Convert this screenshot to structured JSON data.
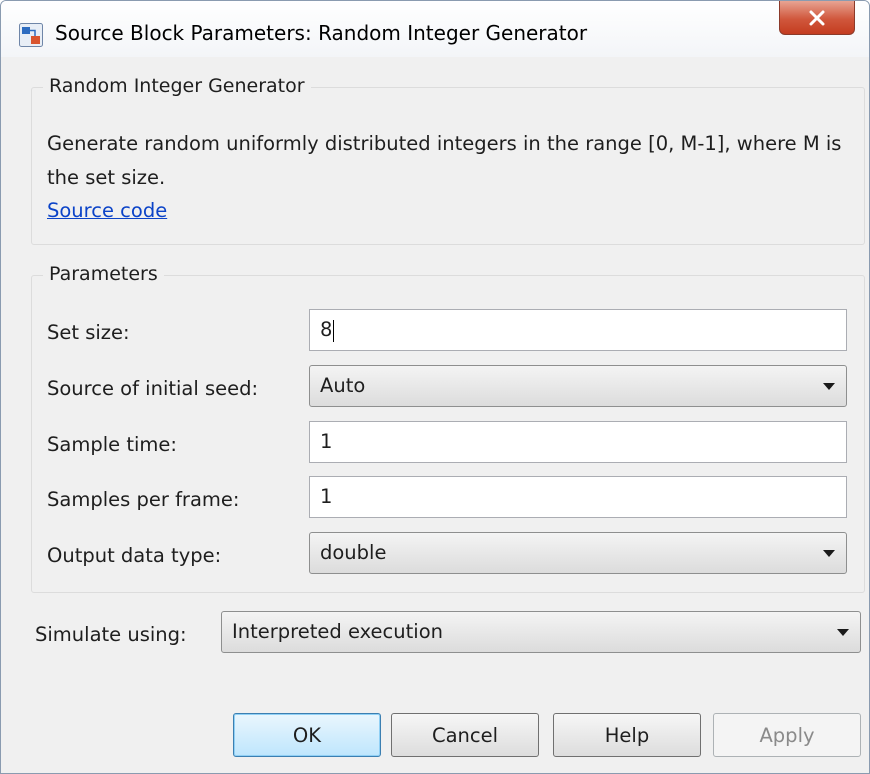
{
  "window": {
    "title": "Source Block Parameters: Random Integer Generator"
  },
  "description_group": {
    "title": "Random Integer Generator",
    "text": "Generate random uniformly distributed integers in the range [0, M-1], where M is the set size.",
    "link": "Source code"
  },
  "parameters_group": {
    "title": "Parameters",
    "set_size": {
      "label": "Set size:",
      "value": "8"
    },
    "initial_seed": {
      "label": "Source of initial seed:",
      "value": "Auto"
    },
    "sample_time": {
      "label": "Sample time:",
      "value": "1"
    },
    "samples_per_frame": {
      "label": "Samples per frame:",
      "value": "1"
    },
    "output_data_type": {
      "label": "Output data type:",
      "value": "double"
    }
  },
  "simulate": {
    "label": "Simulate using:",
    "value": "Interpreted execution"
  },
  "buttons": {
    "ok": "OK",
    "cancel": "Cancel",
    "help": "Help",
    "apply": "Apply"
  },
  "icons": {
    "app": "simulink-block-icon",
    "close": "close-icon",
    "dropdown": "chevron-down-icon"
  },
  "colors": {
    "close_button": "#d0573c",
    "link": "#0b43c8",
    "default_button": "#bee6fd"
  }
}
